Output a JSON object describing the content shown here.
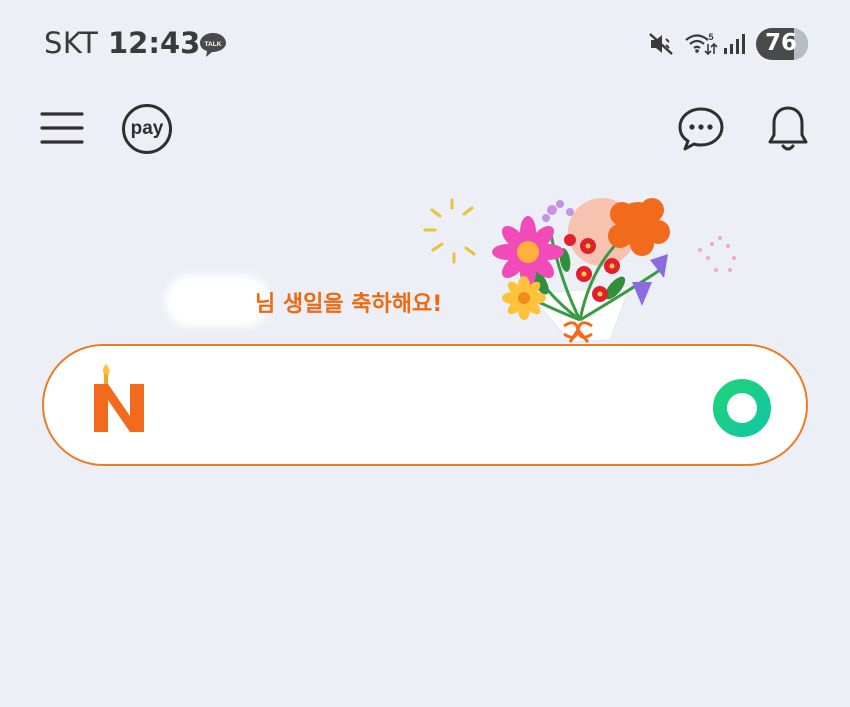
{
  "status_bar": {
    "carrier": "SKT",
    "time": "12:43",
    "talk_badge": "TALK",
    "wifi_band": "5",
    "battery": "76",
    "icons": [
      "talk-icon",
      "mute-icon",
      "wifi-icon",
      "signal-icon",
      "battery-icon"
    ]
  },
  "nav": {
    "pay_label": "pay",
    "icons": [
      "menu-icon",
      "chat-icon",
      "bell-icon"
    ]
  },
  "banner": {
    "text": "님 생일을 축하해요!"
  },
  "search": {
    "logo": "N",
    "value": "",
    "placeholder": ""
  },
  "colors": {
    "background": "#eceff5",
    "accent_orange": "#ee7a26",
    "green": "#1fd27a"
  }
}
